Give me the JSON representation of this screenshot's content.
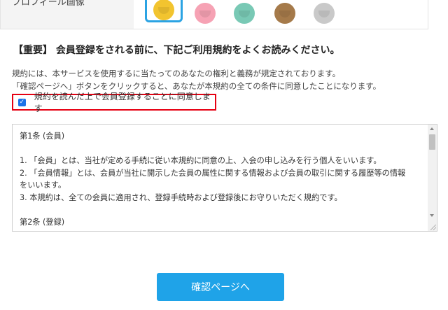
{
  "profile": {
    "label": "プロフィール画像",
    "avatars": [
      {
        "icon": "yellow-character-icon",
        "color": "#f2c42f",
        "selected": true
      },
      {
        "icon": "pink-girl-icon",
        "color": "#f6a2b4",
        "selected": false
      },
      {
        "icon": "boy-icon",
        "color": "#79c9b5",
        "selected": false
      },
      {
        "icon": "brown-hair-girl-icon",
        "color": "#a57a4a",
        "selected": false
      },
      {
        "icon": "gray-cat-icon",
        "color": "#c9c9c9",
        "selected": false
      }
    ],
    "accent": "#2ba3e3"
  },
  "notice": {
    "heading": "【重要】 会員登録をされる前に、下記ご利用規約をよくお読みください。",
    "line1": "規約には、本サービスを使用するに当たってのあなたの権利と義務が規定されております。",
    "line2": "「確認ページへ」ボタンをクリックすると、あなたが本規約の全ての条件に同意したことになります。"
  },
  "agreement": {
    "label": "規約を読んだ上で会員登録することに同意します",
    "checked": true,
    "highlight_color": "#e60012"
  },
  "terms": {
    "article1_title": "第1条 (会員)",
    "item1": "1. 「会員」とは、当社が定める手続に従い本規約に同意の上、入会の申し込みを行う個人をいいます。",
    "item2a": "2. 「会員情報」とは、会員が当社に開示した会員の属性に関する情報および会員の取引に関する履歴等の情報",
    "item2b": "をいいます。",
    "item3": "3. 本規約は、全ての会員に適用され、登録手続時および登録後にお守りいただく規約です。",
    "article2_title": "第2条 (登録)"
  },
  "confirm_button": {
    "label": "確認ページへ",
    "color": "#1fa3e8"
  }
}
